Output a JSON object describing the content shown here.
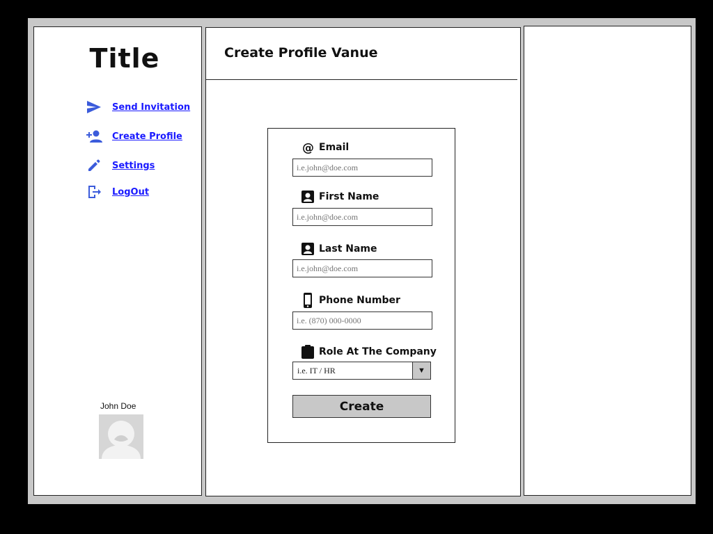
{
  "sidebar": {
    "title": "Title",
    "nav": [
      {
        "label": "Send Invitation",
        "icon": "send-icon"
      },
      {
        "label": "Create Profile",
        "icon": "person-add-icon"
      },
      {
        "label": "Settings",
        "icon": "pencil-icon"
      },
      {
        "label": "LogOut",
        "icon": "logout-icon"
      }
    ],
    "user": {
      "name": "John Doe"
    }
  },
  "main": {
    "page_title": "Create Profile Vanue",
    "form": {
      "email": {
        "label": "Email",
        "placeholder": "i.e.john@doe.com",
        "icon": "at-icon"
      },
      "first_name": {
        "label": "First Name",
        "placeholder": "i.e.john@doe.com",
        "icon": "contact-icon"
      },
      "last_name": {
        "label": "Last Name",
        "placeholder": "i.e.john@doe.com",
        "icon": "contact-icon"
      },
      "phone": {
        "label": "Phone Number",
        "placeholder": "i.e. (870) 000-0000",
        "icon": "phone-icon"
      },
      "role": {
        "label": "Role At The Company",
        "value": "i.e. IT / HR",
        "icon": "clipboard-icon"
      },
      "submit_label": "Create"
    }
  },
  "colors": {
    "link": "#1a1aff",
    "icon_blue": "#3b5bdb",
    "frame": "#c8c8c8",
    "button": "#c8c8c8"
  }
}
